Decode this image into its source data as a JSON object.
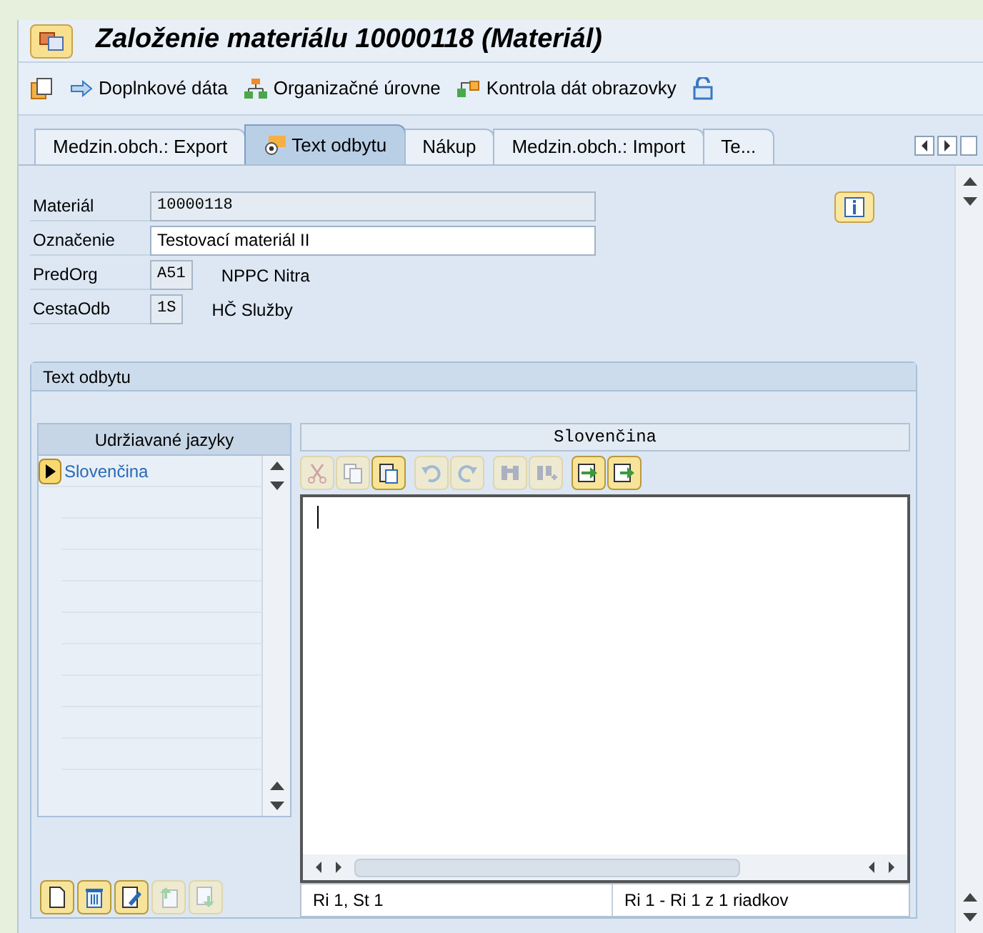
{
  "window": {
    "title": "Založenie materiálu 10000118 (Materiál)"
  },
  "toolbar": [
    {
      "label": "Doplnkové dáta",
      "kind": "arrow"
    },
    {
      "label": "Organizačné úrovne",
      "kind": "org"
    },
    {
      "label": "Kontrola dát obrazovky",
      "kind": "check"
    }
  ],
  "tabs": [
    {
      "label": "Medzin.obch.: Export",
      "selected": false
    },
    {
      "label": "Text odbytu",
      "selected": true
    },
    {
      "label": "Nákup",
      "selected": false
    },
    {
      "label": "Medzin.obch.: Import",
      "selected": false
    },
    {
      "label": "Te...",
      "selected": false
    }
  ],
  "fields": [
    {
      "label": "Materiál",
      "value": "10000118",
      "editable": false,
      "kind": "long"
    },
    {
      "label": "Označenie",
      "value": "Testovací materiál II",
      "editable": true,
      "kind": "long"
    },
    {
      "label": "PredOrg",
      "value": "A51",
      "editable": false,
      "kind": "short",
      "description": "NPPC Nitra"
    },
    {
      "label": "CestaOdb",
      "value": "1S",
      "editable": false,
      "kind": "short",
      "description": "HČ Služby"
    }
  ],
  "section": {
    "title": "Text odbytu"
  },
  "languages": {
    "header": "Udržiavané jazyky",
    "items": [
      {
        "label": "Slovenčina",
        "selected": true
      }
    ]
  },
  "editor": {
    "header": "Slovenčina",
    "tools": [
      {
        "kind": "cut",
        "disabled": true
      },
      {
        "kind": "copy",
        "disabled": true
      },
      {
        "kind": "paste",
        "disabled": false
      },
      {
        "kind": "undo",
        "disabled": true
      },
      {
        "kind": "redo",
        "disabled": true
      },
      {
        "kind": "find",
        "disabled": true
      },
      {
        "kind": "findnext",
        "disabled": true
      },
      {
        "kind": "import",
        "disabled": false
      },
      {
        "kind": "export",
        "disabled": false
      }
    ],
    "status": [
      "Ri 1, St 1",
      "Ri 1 - Ri 1 z 1 riadkov"
    ]
  },
  "language_actions": [
    {
      "kind": "new",
      "disabled": false
    },
    {
      "kind": "delete",
      "disabled": false
    },
    {
      "kind": "edit",
      "disabled": false
    },
    {
      "kind": "up",
      "disabled": true
    },
    {
      "kind": "down",
      "disabled": true
    }
  ]
}
